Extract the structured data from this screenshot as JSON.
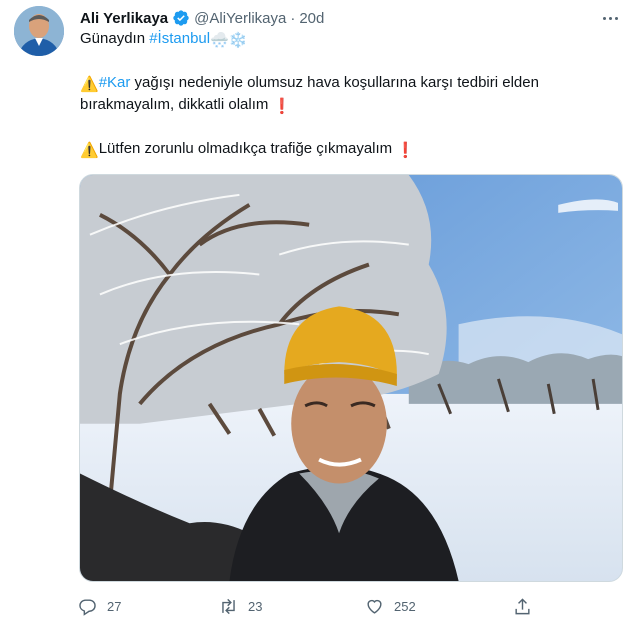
{
  "tweet": {
    "author": {
      "display_name": "Ali Yerlikaya",
      "handle": "@AliYerlikaya",
      "separator": "·",
      "time": "20d",
      "verified": true,
      "avatar_icon": "profile-photo"
    },
    "text": {
      "line1_prefix": "Günaydın",
      "line1_hashtag": "#İstanbul",
      "line1_emojis": "🌨️❄️",
      "p2_warning": "⚠️",
      "p2_hashtag": "#Kar",
      "p2_rest": " yağışı nedeniyle olumsuz hava koşullarına karşı tedbiri elden bırakmayalım, dikkatli olalım",
      "p2_exclaim": "❗",
      "p3_warning": "⚠️",
      "p3_text": "Lütfen zorunlu olmadıkça trafiğe çıkmayalım",
      "p3_exclaim": "❗"
    },
    "media": {
      "description_icon": "photo-icon"
    },
    "actions": {
      "replies": "27",
      "retweets": "23",
      "likes": "252"
    },
    "colors": {
      "accent": "#1d9bf0",
      "text": "#0f1419",
      "secondary": "#536471"
    }
  }
}
